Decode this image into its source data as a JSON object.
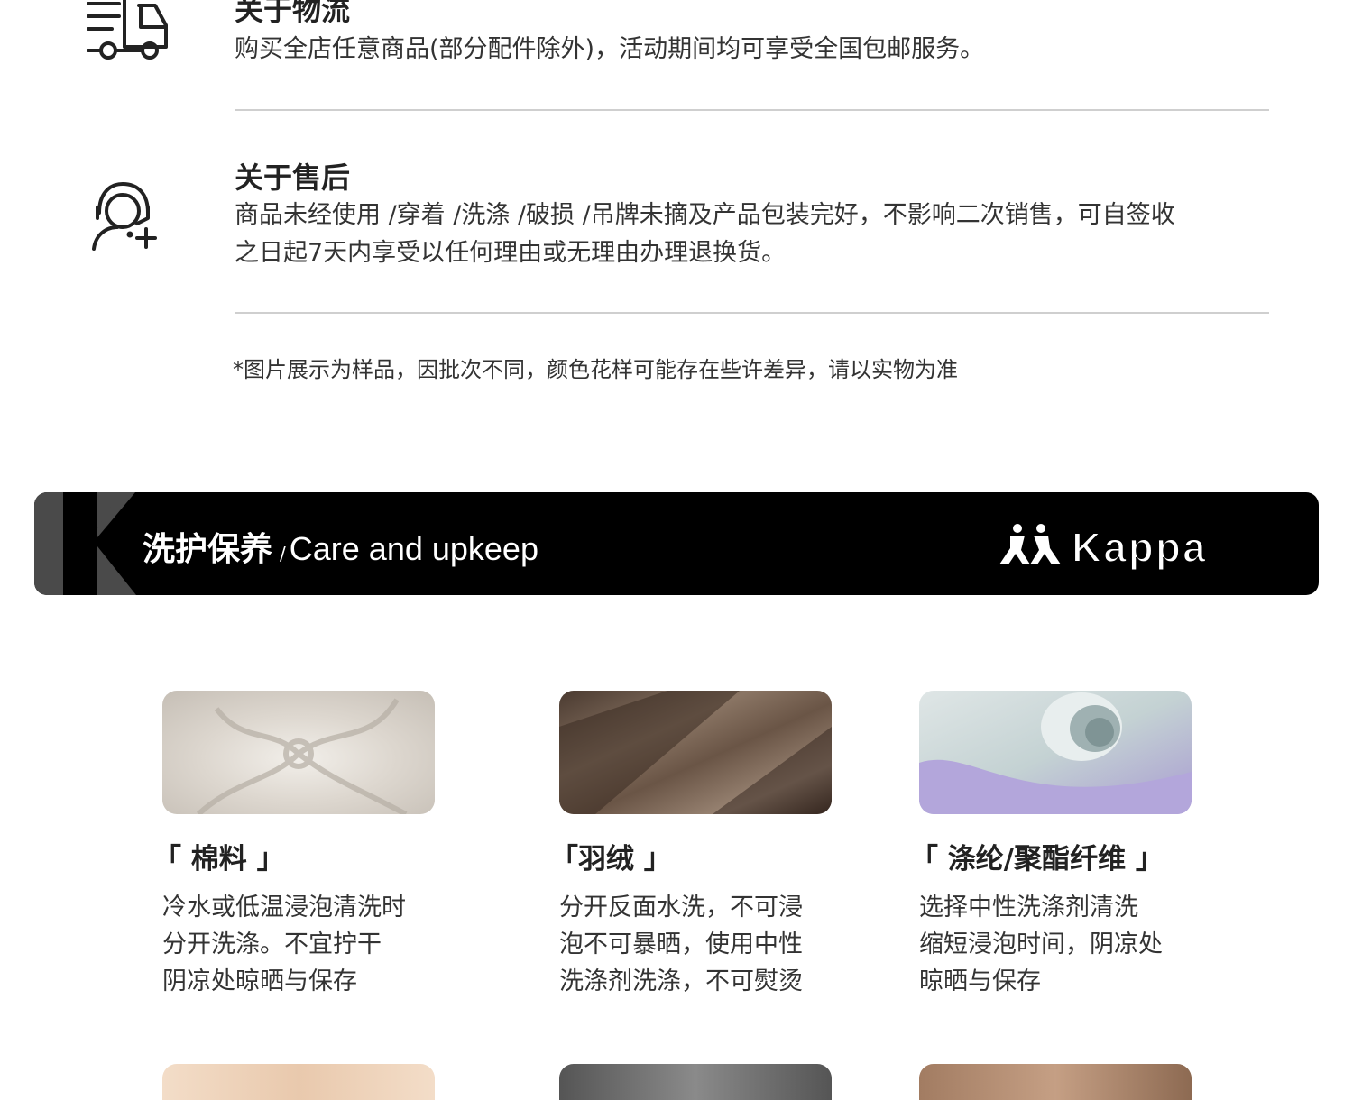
{
  "services": [
    {
      "icon": "delivery-truck-icon",
      "title": "关于物流",
      "text": "购买全店任意商品(部分配件除外)，活动期间均可享受全国包邮服务。"
    },
    {
      "icon": "customer-service-icon",
      "title": "关于售后",
      "text_lines": [
        "商品未经使用 /穿着 /洗涤 /破损 /吊牌未摘及产品包装完好，不影响二次销售，可自签收",
        "之日起7天内享受以任何理由或无理由办理退换货。"
      ]
    }
  ],
  "disclaimer": "*图片展示为样品，因批次不同，颜色花样可能存在些许差异，请以实物为准",
  "banner": {
    "title_zh": "洗护保养",
    "separator": "/",
    "title_en": "Care and upkeep",
    "brand": "Kappa",
    "background_color": "#000000",
    "k_block_color": "#4a4a4a"
  },
  "care_items": [
    {
      "title": "「 棉料 」",
      "lines": [
        "冷水或低温浸泡清洗时",
        "分开洗涤。不宜拧干",
        "阴凉处晾晒与保存"
      ],
      "fabric_colors": [
        "#e8e4df",
        "#c9c3bb"
      ]
    },
    {
      "title": "「羽绒 」",
      "lines": [
        "分开反面水洗，不可浸",
        "泡不可暴晒，使用中性",
        "洗涤剂洗涤，不可熨烫"
      ],
      "fabric_colors": [
        "#7d6a5c",
        "#3b2c23"
      ]
    },
    {
      "title": "「 涤纶/聚酯纤维 」",
      "lines": [
        "选择中性洗涤剂清洗",
        "缩短浸泡时间，阴凉处",
        "晾晒与保存"
      ],
      "fabric_colors": [
        "#c9d6d6",
        "#a99ad0"
      ]
    }
  ],
  "next_row_swatch_colors": [
    "#f1d9c4",
    "#6b6b6b",
    "#b08a70"
  ]
}
